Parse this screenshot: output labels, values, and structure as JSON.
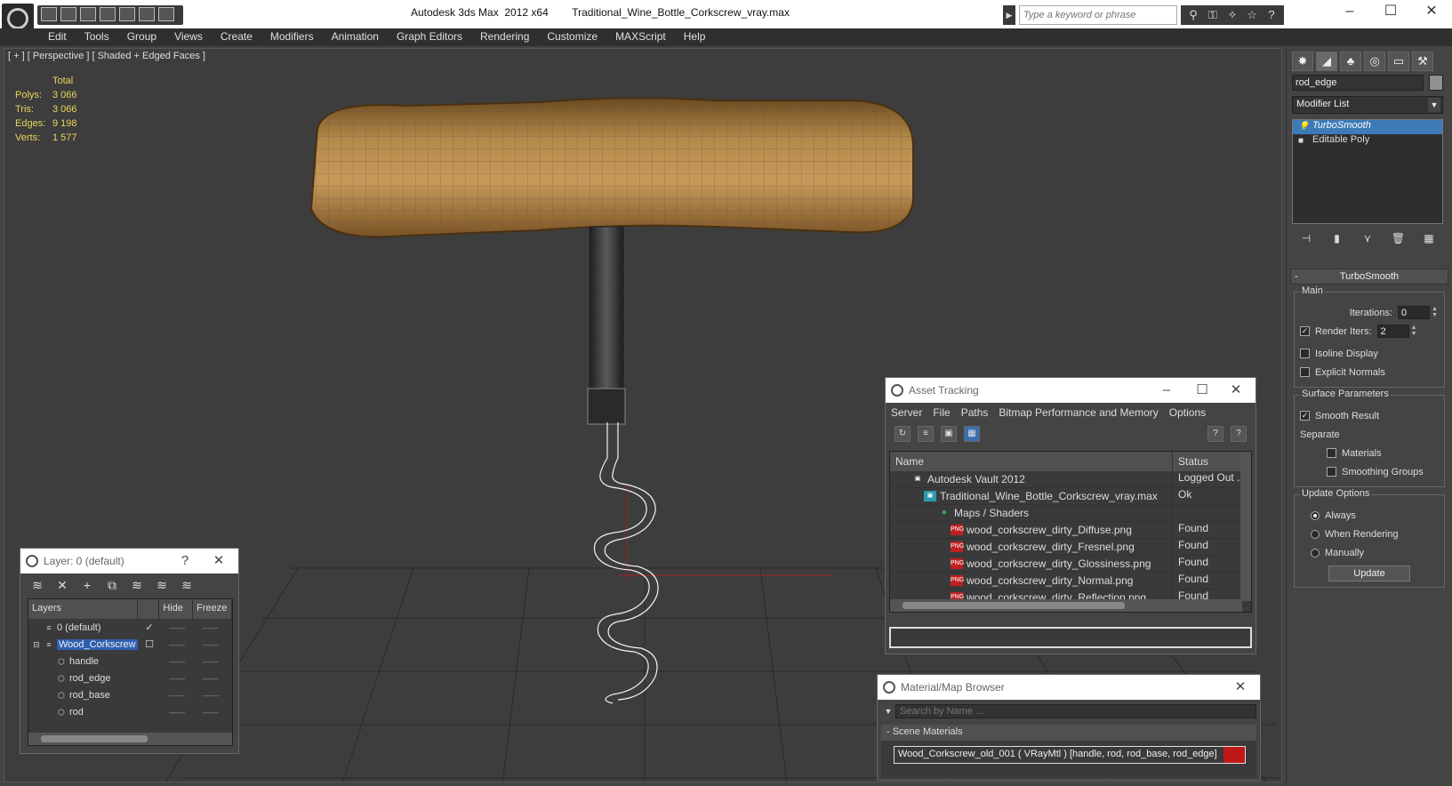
{
  "titlebar": {
    "title": "Autodesk 3ds Max  2012 x64        Traditional_Wine_Bottle_Corkscrew_vray.max",
    "search_placeholder": "Type a keyword or phrase"
  },
  "menu": [
    "Edit",
    "Tools",
    "Group",
    "Views",
    "Create",
    "Modifiers",
    "Animation",
    "Graph Editors",
    "Rendering",
    "Customize",
    "MAXScript",
    "Help"
  ],
  "viewport": {
    "label": "[ + ] [ Perspective ] [ Shaded + Edged Faces ]",
    "stats": {
      "header": "Total",
      "rows": [
        {
          "k": "Polys:",
          "v": "3 066"
        },
        {
          "k": "Tris:",
          "v": "3 066"
        },
        {
          "k": "Edges:",
          "v": "9 198"
        },
        {
          "k": "Verts:",
          "v": "1 577"
        }
      ]
    }
  },
  "command_panel": {
    "object_name": "rod_edge",
    "modifier_list": "Modifier List",
    "stack": [
      "TurboSmooth",
      "Editable Poly"
    ],
    "rollout_title": "TurboSmooth",
    "main_group": "Main",
    "iterations_label": "Iterations:",
    "iterations_value": "0",
    "render_iters_label": "Render Iters:",
    "render_iters_value": "2",
    "isoline_label": "Isoline Display",
    "explicit_normals_label": "Explicit Normals",
    "surface_group": "Surface Parameters",
    "smooth_result_label": "Smooth Result",
    "separate_label": "Separate",
    "materials_label": "Materials",
    "smoothing_groups_label": "Smoothing Groups",
    "update_group": "Update Options",
    "always_label": "Always",
    "when_rendering_label": "When Rendering",
    "manually_label": "Manually",
    "update_button": "Update"
  },
  "layer_window": {
    "title": "Layer: 0 (default)",
    "help": "?",
    "col_layers": "Layers",
    "col_hide": "Hide",
    "col_freeze": "Freeze",
    "rows": [
      {
        "name": "0 (default)",
        "check": "✓",
        "indent": 1
      },
      {
        "name": "Wood_Corkscrew",
        "check": "",
        "indent": 0
      },
      {
        "name": "handle",
        "check": "",
        "indent": 2
      },
      {
        "name": "rod_edge",
        "check": "",
        "indent": 2
      },
      {
        "name": "rod_base",
        "check": "",
        "indent": 2
      },
      {
        "name": "rod",
        "check": "",
        "indent": 2
      }
    ]
  },
  "asset_tracking": {
    "title": "Asset Tracking",
    "menu": [
      "Server",
      "File",
      "Paths",
      "Bitmap Performance and Memory",
      "Options"
    ],
    "col_name": "Name",
    "col_status": "Status",
    "rows": [
      {
        "name": "Autodesk Vault 2012",
        "status": "Logged Out ..."
      },
      {
        "name": "Traditional_Wine_Bottle_Corkscrew_vray.max",
        "status": "Ok"
      },
      {
        "name": "Maps / Shaders",
        "status": ""
      },
      {
        "name": "wood_corkscrew_dirty_Diffuse.png",
        "status": "Found"
      },
      {
        "name": "wood_corkscrew_dirty_Fresnel.png",
        "status": "Found"
      },
      {
        "name": "wood_corkscrew_dirty_Glossiness.png",
        "status": "Found"
      },
      {
        "name": "wood_corkscrew_dirty_Normal.png",
        "status": "Found"
      },
      {
        "name": "wood_corkscrew_dirty_Reflection.png",
        "status": "Found"
      }
    ]
  },
  "material_browser": {
    "title": "Material/Map Browser",
    "search_placeholder": "Search by Name ...",
    "group": "- Scene Materials",
    "item": "Wood_Corkscrew_old_001  ( VRayMtl ) [handle, rod, rod_base, rod_edge]"
  }
}
